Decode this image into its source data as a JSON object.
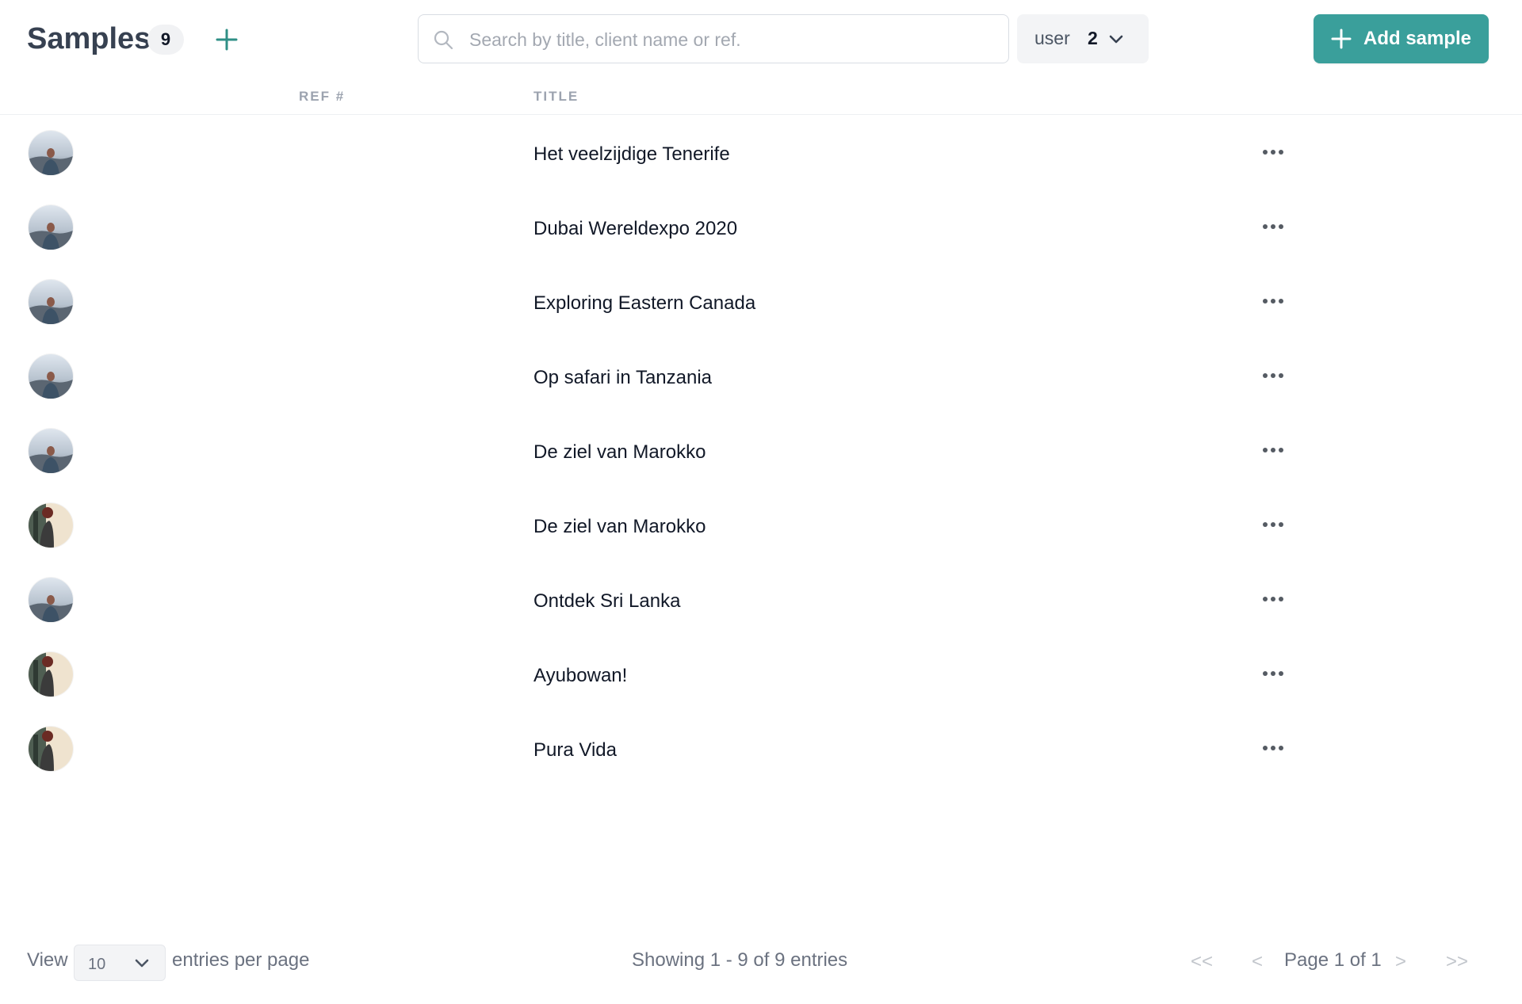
{
  "header": {
    "title": "Samples",
    "count": "9",
    "search_placeholder": "Search by title, client name or ref.",
    "search_value": "",
    "user_filter_label": "user",
    "user_filter_value": "2",
    "add_button_label": "Add sample"
  },
  "columns": {
    "ref": "REF #",
    "title": "TITLE"
  },
  "rows": [
    {
      "avatar": "avatar-a",
      "ref": "",
      "title": "Het veelzijdige Tenerife"
    },
    {
      "avatar": "avatar-a",
      "ref": "",
      "title": "Dubai Wereldexpo 2020"
    },
    {
      "avatar": "avatar-a",
      "ref": "",
      "title": "Exploring Eastern Canada"
    },
    {
      "avatar": "avatar-a",
      "ref": "",
      "title": "Op safari in Tanzania"
    },
    {
      "avatar": "avatar-a",
      "ref": "",
      "title": "De ziel van Marokko"
    },
    {
      "avatar": "avatar-b",
      "ref": "",
      "title": "De ziel van Marokko"
    },
    {
      "avatar": "avatar-a",
      "ref": "",
      "title": "Ontdek Sri Lanka"
    },
    {
      "avatar": "avatar-b",
      "ref": "",
      "title": "Ayubowan!"
    },
    {
      "avatar": "avatar-b",
      "ref": "",
      "title": "Pura Vida"
    }
  ],
  "footer": {
    "view_label": "View",
    "per_page_value": "10",
    "per_page_label": "entries per page",
    "showing": "Showing 1 - 9 of 9 entries",
    "first": "<<",
    "prev": "<",
    "page": "Page 1 of 1",
    "next": ">",
    "last": ">>"
  },
  "icons": {
    "add": "plus-icon",
    "search": "search-icon",
    "dropdown": "chevron-down-icon",
    "row_actions": "more-horizontal-icon"
  },
  "colors": {
    "accent": "#3a9f9b",
    "add_plus": "#2f8f86",
    "muted_text": "#6b7280",
    "header_text": "#9ca3af"
  }
}
